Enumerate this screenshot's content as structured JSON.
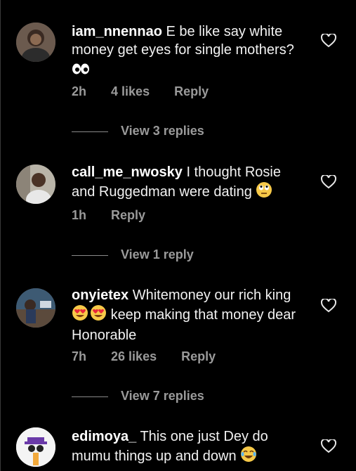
{
  "colors": {
    "background": "#000000",
    "text": "#f2f2f2",
    "meta": "#9a9a9a"
  },
  "comments": [
    {
      "username": "iam_nnennao",
      "text": "E be like say white money get eyes for single mothers?",
      "emoji": "eyes",
      "time": "2h",
      "likes": "4 likes",
      "reply": "Reply",
      "view_replies": "View 3 replies"
    },
    {
      "username": "call_me_nwosky",
      "text": "I thought Rosie and Ruggedman were dating",
      "emoji": "rolling-eyes",
      "time": "1h",
      "likes": "",
      "reply": "Reply",
      "view_replies": "View 1 reply"
    },
    {
      "username": "onyietex",
      "text_a": "Whitemoney our rich king",
      "text_b": "keep making that money dear Honorable",
      "emoji": "heart-eyes",
      "time": "7h",
      "likes": "26 likes",
      "reply": "Reply",
      "view_replies": "View 7 replies"
    },
    {
      "username": "edimoya_",
      "text": "This one just Dey do mumu things up and down",
      "emoji": "tears-of-joy"
    }
  ]
}
